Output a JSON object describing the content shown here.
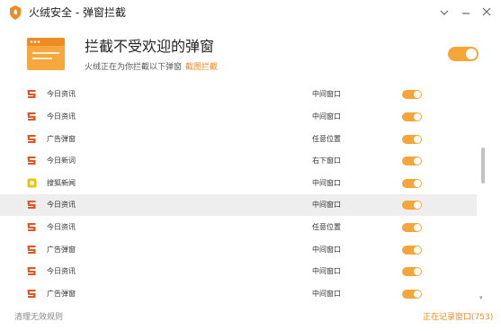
{
  "window": {
    "title": "火绒安全 - 弹窗拦截",
    "buttons": [
      "settings-dropdown",
      "minimize",
      "close"
    ]
  },
  "header": {
    "title": "拦截不受欢迎的弹窗",
    "subtitle": "火绒正在为你拦截以下弹窗",
    "link": "截图拦截",
    "master_toggle_on": true
  },
  "rows": [
    {
      "name": "今日资讯",
      "position": "中间窗口",
      "enabled": true
    },
    {
      "name": "今日资讯",
      "position": "中间窗口",
      "enabled": true
    },
    {
      "name": "广告弹窗",
      "position": "任意位置",
      "enabled": true
    },
    {
      "name": "今日新词",
      "position": "右下窗口",
      "enabled": true
    },
    {
      "name": "搜狐新闻",
      "position": "中间窗口",
      "enabled": true
    },
    {
      "name": "今日资讯",
      "position": "中间窗口",
      "enabled": true,
      "highlighted": true
    },
    {
      "name": "今日资讯",
      "position": "任意位置",
      "enabled": true
    },
    {
      "name": "广告弹窗",
      "position": "中间窗口",
      "enabled": true
    },
    {
      "name": "今日资讯",
      "position": "中间窗口",
      "enabled": true
    },
    {
      "name": "广告弹窗",
      "position": "中间窗口",
      "enabled": true
    }
  ],
  "footer": {
    "left": "清理无效规则",
    "right": "正在记录窗口(753)"
  },
  "colors": {
    "accent": "#f08a24",
    "toggle": "#f5a53a",
    "app_icon": "#e8541e"
  }
}
